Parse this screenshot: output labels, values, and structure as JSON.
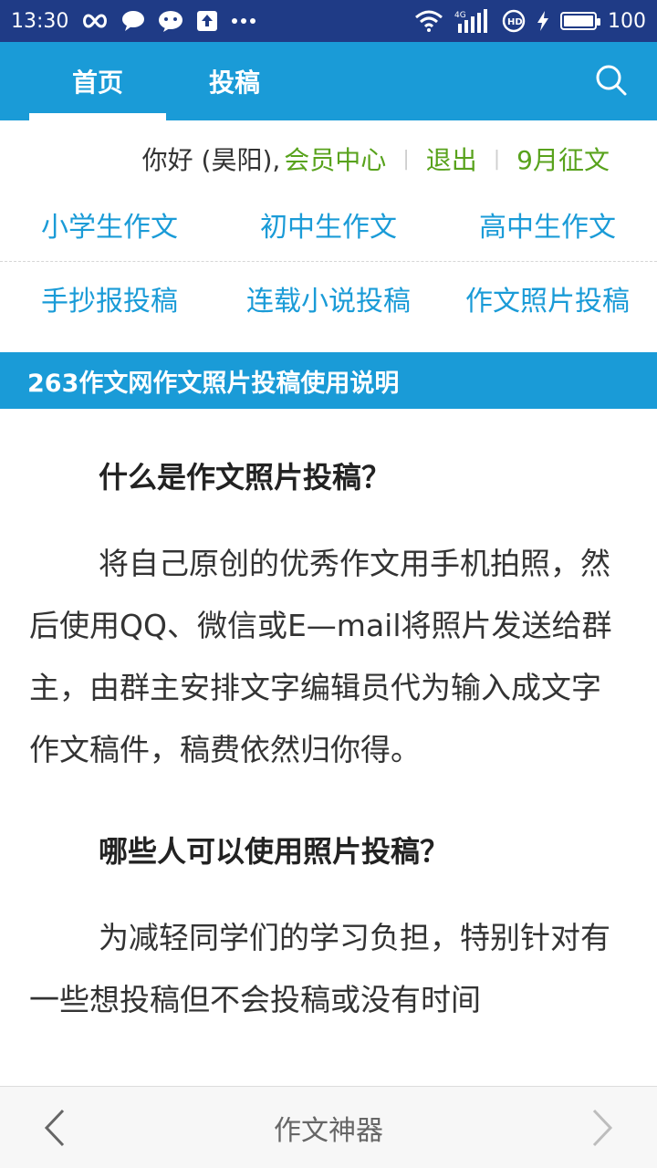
{
  "status_bar": {
    "time": "13:30",
    "network": "4G",
    "battery": "100",
    "battery_level_percent": 100,
    "icons": [
      "infinity-icon",
      "chat-bubble-icon",
      "wechat-icon",
      "upload-icon",
      "more-dots-icon",
      "wifi-icon",
      "signal-icon",
      "hd-icon",
      "charging-icon",
      "battery-icon"
    ]
  },
  "header": {
    "tabs": [
      {
        "label": "首页",
        "active": true
      },
      {
        "label": "投稿",
        "active": false
      }
    ],
    "search_icon": "search-icon"
  },
  "user_bar": {
    "greeting": "你好 (昊阳),",
    "links": [
      "会员中心",
      "退出",
      "9月征文"
    ],
    "separator": "|"
  },
  "nav": {
    "rows": [
      [
        "小学生作文",
        "初中生作文",
        "高中生作文"
      ],
      [
        "手抄报投稿",
        "连载小说投稿",
        "作文照片投稿"
      ]
    ]
  },
  "section_title": "263作文网作文照片投稿使用说明",
  "article": {
    "heading1": "什么是作文照片投稿？",
    "paragraph1": "将自己原创的优秀作文用手机拍照，然后使用QQ、微信或E—mail将照片发送给群主，由群主安排文字编辑员代为输入成文字作文稿件，稿费依然归你得。",
    "heading2": "哪些人可以使用照片投稿？",
    "paragraph2": "为减轻同学们的学习负担，特别针对有一些想投稿但不会投稿或没有时间"
  },
  "bottom_bar": {
    "title": "作文神器",
    "back_icon": "chevron-left-icon",
    "forward_icon": "chevron-right-icon"
  },
  "colors": {
    "status_bar_bg": "#1f3b86",
    "primary_blue": "#1a9bd7",
    "link_green": "#58a21c"
  }
}
